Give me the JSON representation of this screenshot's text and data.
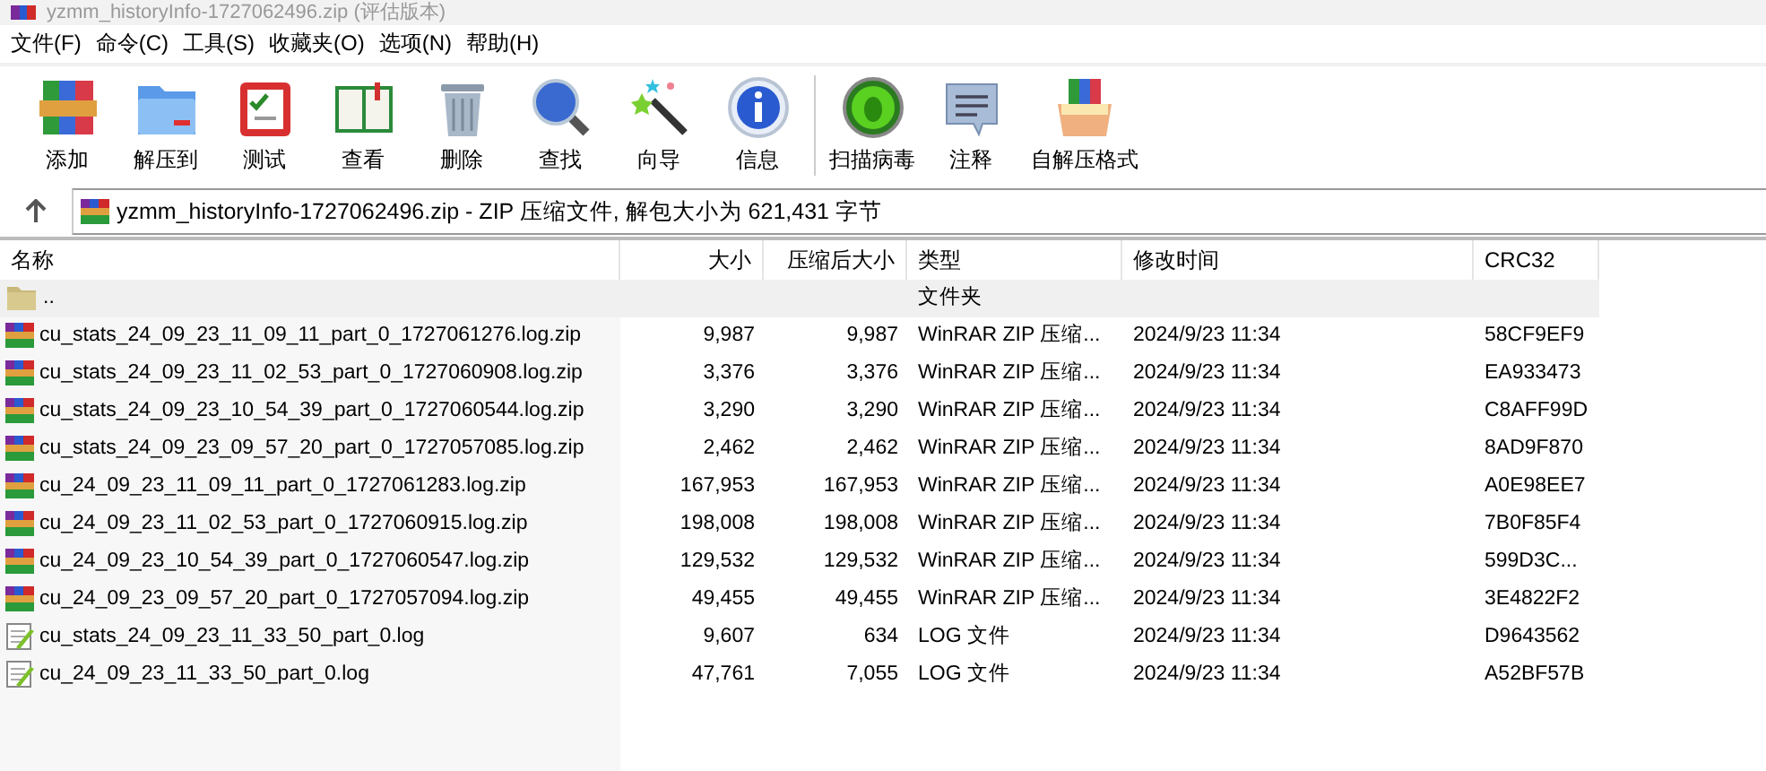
{
  "window": {
    "title": "yzmm_historyInfo-1727062496.zip (评估版本)"
  },
  "menu": [
    "文件(F)",
    "命令(C)",
    "工具(S)",
    "收藏夹(O)",
    "选项(N)",
    "帮助(H)"
  ],
  "toolbar": {
    "groups": [
      [
        {
          "label": "添加",
          "kind": "add"
        },
        {
          "label": "解压到",
          "kind": "extract"
        },
        {
          "label": "测试",
          "kind": "test"
        },
        {
          "label": "查看",
          "kind": "view"
        },
        {
          "label": "删除",
          "kind": "delete"
        },
        {
          "label": "查找",
          "kind": "find"
        },
        {
          "label": "向导",
          "kind": "wizard"
        },
        {
          "label": "信息",
          "kind": "info"
        }
      ],
      [
        {
          "label": "扫描病毒",
          "kind": "scan"
        },
        {
          "label": "注释",
          "kind": "comment"
        },
        {
          "label": "自解压格式",
          "kind": "sfx"
        }
      ]
    ]
  },
  "address": {
    "text": "yzmm_historyInfo-1727062496.zip - ZIP 压缩文件, 解包大小为 621,431 字节"
  },
  "table": {
    "columns": [
      "名称",
      "大小",
      "压缩后大小",
      "类型",
      "修改时间",
      "CRC32"
    ],
    "rows": [
      {
        "kind": "folder",
        "name": "..",
        "size": "",
        "packed": "",
        "type": "文件夹",
        "modified": "",
        "crc": ""
      },
      {
        "kind": "archive",
        "name": "cu_stats_24_09_23_11_09_11_part_0_1727061276.log.zip",
        "size": "9,987",
        "packed": "9,987",
        "type": "WinRAR ZIP 压缩...",
        "modified": "2024/9/23 11:34",
        "crc": "58CF9EF9"
      },
      {
        "kind": "archive",
        "name": "cu_stats_24_09_23_11_02_53_part_0_1727060908.log.zip",
        "size": "3,376",
        "packed": "3,376",
        "type": "WinRAR ZIP 压缩...",
        "modified": "2024/9/23 11:34",
        "crc": "EA933473"
      },
      {
        "kind": "archive",
        "name": "cu_stats_24_09_23_10_54_39_part_0_1727060544.log.zip",
        "size": "3,290",
        "packed": "3,290",
        "type": "WinRAR ZIP 压缩...",
        "modified": "2024/9/23 11:34",
        "crc": "C8AFF99D"
      },
      {
        "kind": "archive",
        "name": "cu_stats_24_09_23_09_57_20_part_0_1727057085.log.zip",
        "size": "2,462",
        "packed": "2,462",
        "type": "WinRAR ZIP 压缩...",
        "modified": "2024/9/23 11:34",
        "crc": "8AD9F870"
      },
      {
        "kind": "archive",
        "name": "cu_24_09_23_11_09_11_part_0_1727061283.log.zip",
        "size": "167,953",
        "packed": "167,953",
        "type": "WinRAR ZIP 压缩...",
        "modified": "2024/9/23 11:34",
        "crc": "A0E98EE7"
      },
      {
        "kind": "archive",
        "name": "cu_24_09_23_11_02_53_part_0_1727060915.log.zip",
        "size": "198,008",
        "packed": "198,008",
        "type": "WinRAR ZIP 压缩...",
        "modified": "2024/9/23 11:34",
        "crc": "7B0F85F4"
      },
      {
        "kind": "archive",
        "name": "cu_24_09_23_10_54_39_part_0_1727060547.log.zip",
        "size": "129,532",
        "packed": "129,532",
        "type": "WinRAR ZIP 压缩...",
        "modified": "2024/9/23 11:34",
        "crc": "599D3C..."
      },
      {
        "kind": "archive",
        "name": "cu_24_09_23_09_57_20_part_0_1727057094.log.zip",
        "size": "49,455",
        "packed": "49,455",
        "type": "WinRAR ZIP 压缩...",
        "modified": "2024/9/23 11:34",
        "crc": "3E4822F2"
      },
      {
        "kind": "log",
        "name": "cu_stats_24_09_23_11_33_50_part_0.log",
        "size": "9,607",
        "packed": "634",
        "type": "LOG 文件",
        "modified": "2024/9/23 11:34",
        "crc": "D9643562"
      },
      {
        "kind": "log",
        "name": "cu_24_09_23_11_33_50_part_0.log",
        "size": "47,761",
        "packed": "7,055",
        "type": "LOG 文件",
        "modified": "2024/9/23 11:34",
        "crc": "A52BF57B"
      }
    ]
  }
}
